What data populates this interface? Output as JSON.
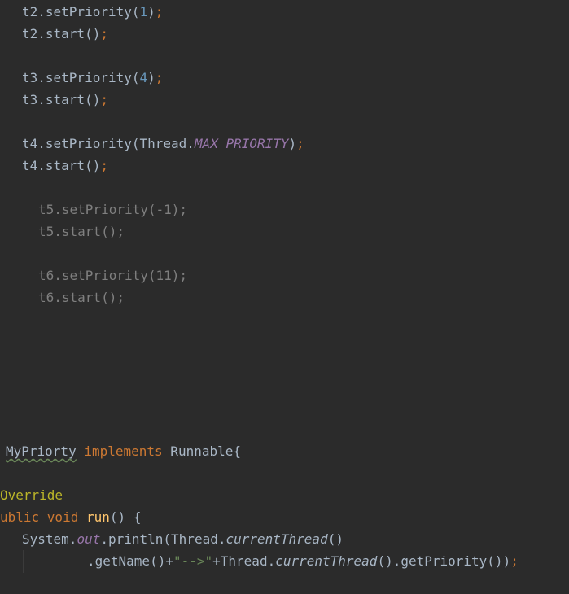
{
  "top_code": {
    "t2_priority": {
      "obj": "t2",
      "call": ".setPriority(",
      "arg": "1",
      "close": ")",
      "semi": ";"
    },
    "t2_start": {
      "obj": "t2",
      "call": ".start()",
      "semi": ";"
    },
    "t3_priority": {
      "obj": "t3",
      "call": ".setPriority(",
      "arg": "4",
      "close": ")",
      "semi": ";"
    },
    "t3_start": {
      "obj": "t3",
      "call": ".start()",
      "semi": ";"
    },
    "t4_priority": {
      "obj": "t4",
      "call": ".setPriority(Thread.",
      "arg": "MAX_PRIORITY",
      "close": ")",
      "semi": ";"
    },
    "t4_start": {
      "obj": "t4",
      "call": ".start()",
      "semi": ";"
    },
    "t5_priority": {
      "text": "t5.setPriority(-1);"
    },
    "t5_start": {
      "text": "t5.start();"
    },
    "t6_priority": {
      "text": "t6.setPriority(11);"
    },
    "t6_start": {
      "text": "t6.start();"
    }
  },
  "bottom_code": {
    "class_decl": {
      "name": "MyPriorty",
      "keyword": "implements",
      "rest": " Runnable{"
    },
    "annotation": "Override",
    "method_decl": {
      "prefix": "ublic void ",
      "name": "run",
      "rest": "() {"
    },
    "println_line": {
      "a": "System.",
      "field": "out",
      "b": ".println(Thread.",
      "m": "currentThread",
      "c": "()"
    },
    "getname_line": {
      "a": ".getName()+",
      "str": "\"-->\"",
      "b": "+Thread.",
      "m": "currentThread",
      "c": "().getPriority())",
      "semi": ";"
    }
  }
}
